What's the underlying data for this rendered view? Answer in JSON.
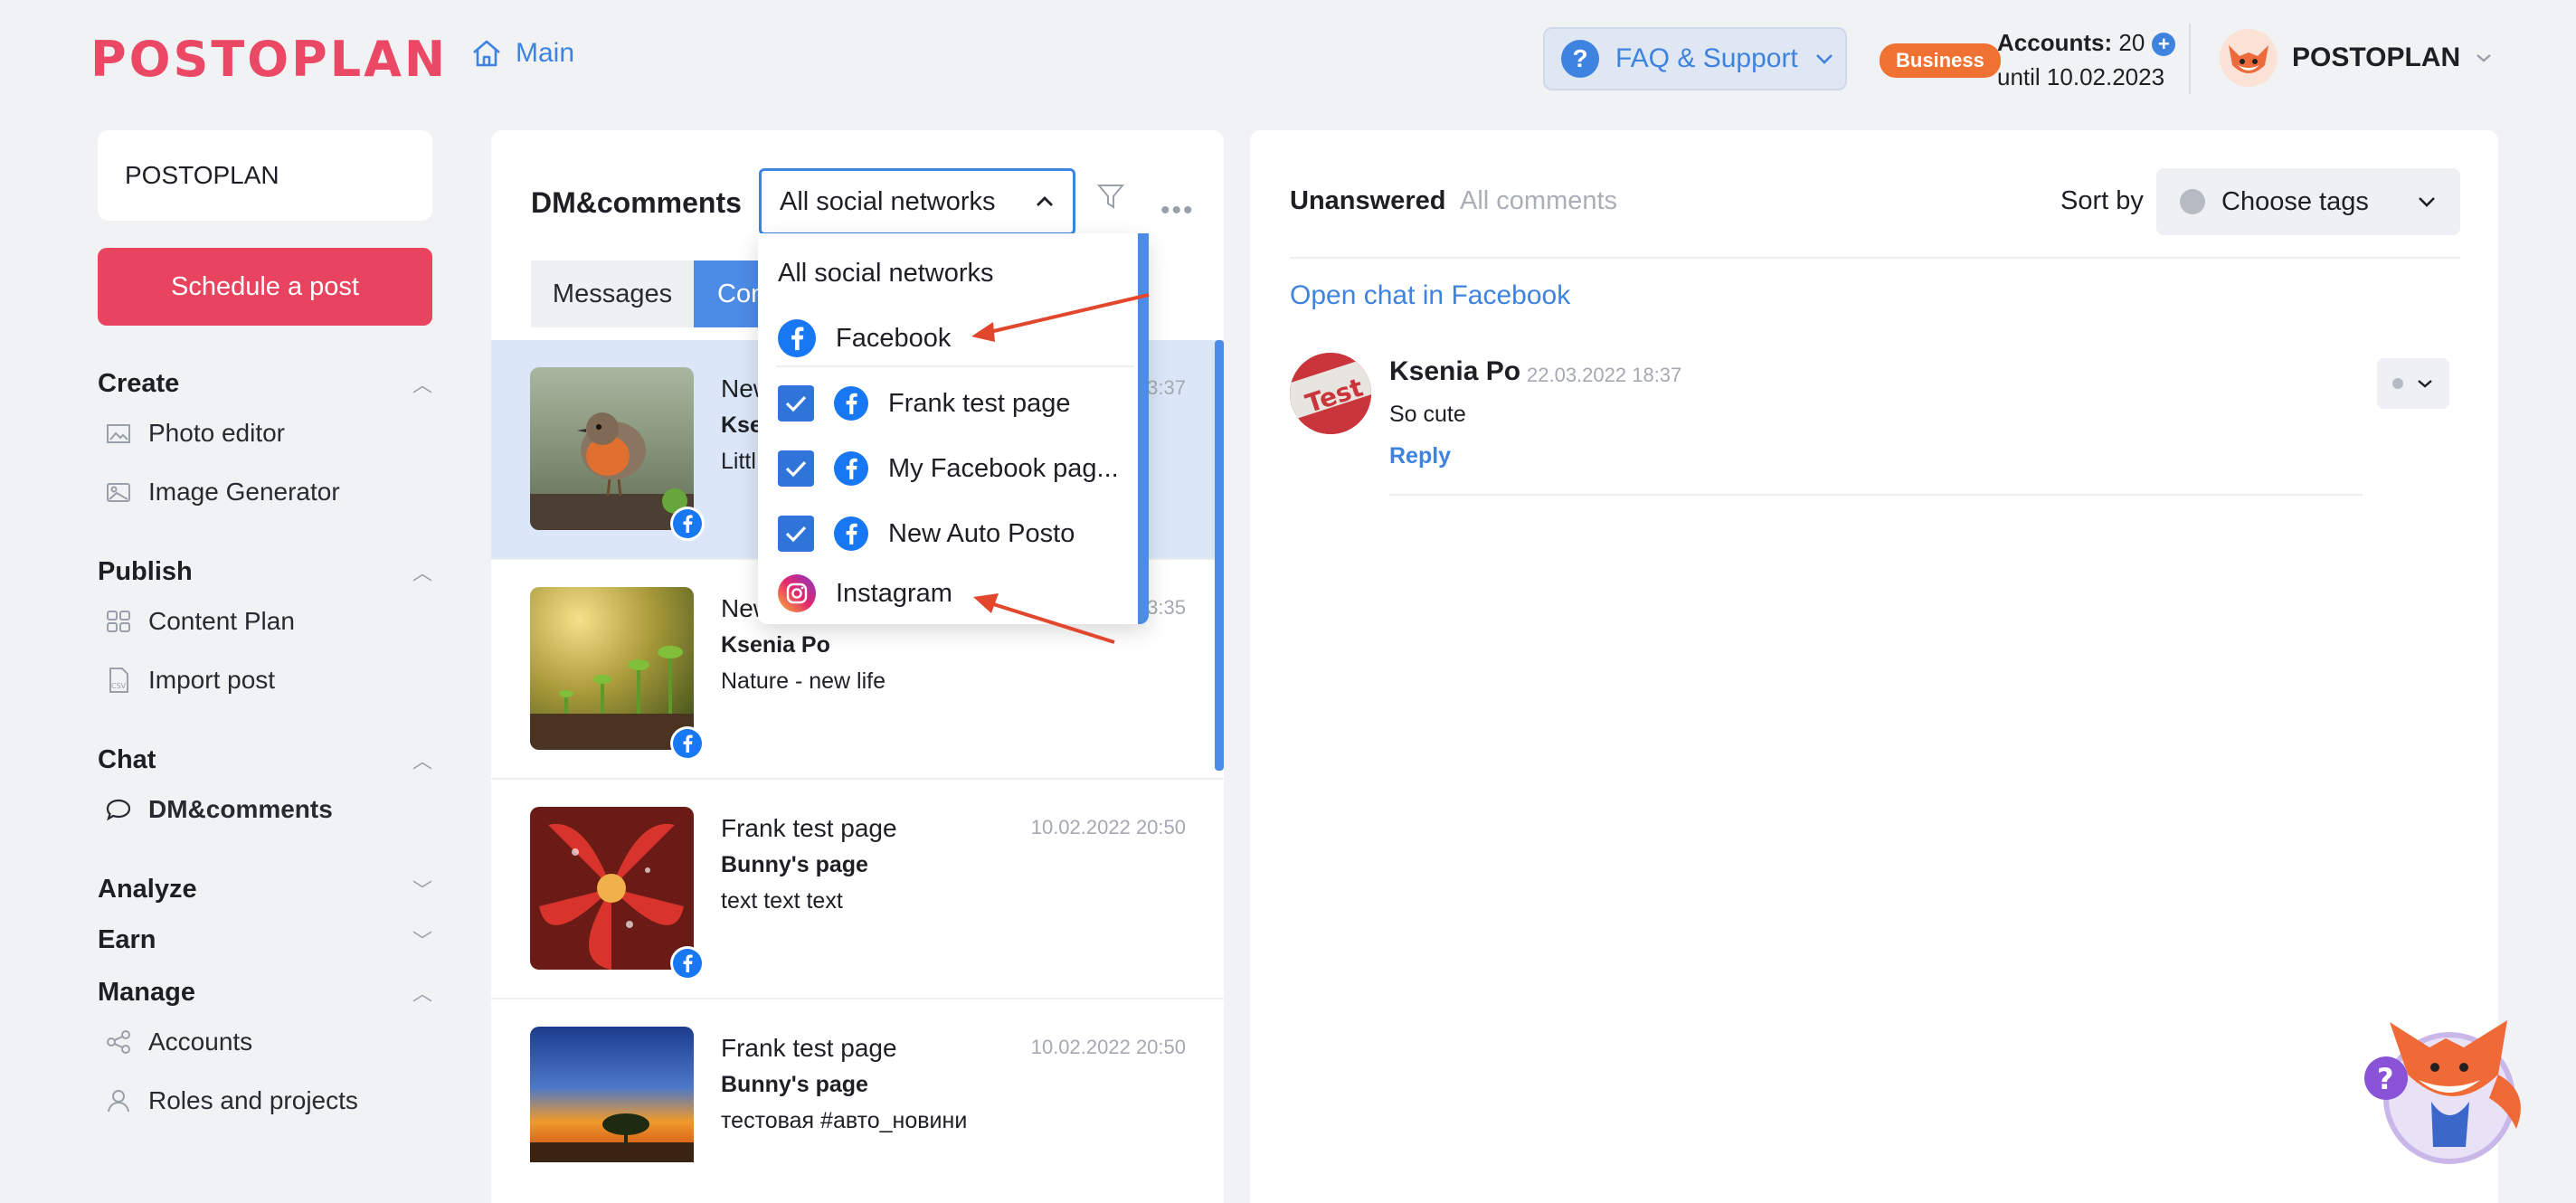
{
  "header": {
    "logo": "POSTOPLAN",
    "home_label": "Main",
    "faq_label": "FAQ & Support",
    "plan_badge": "Business",
    "accounts_label": "Accounts:",
    "accounts_count": "20",
    "until_label": "until 10.02.2023",
    "profile_name": "POSTOPLAN"
  },
  "sidebar": {
    "workspace": "POSTOPLAN",
    "schedule_button": "Schedule a post",
    "sections": {
      "create": "Create",
      "publish": "Publish",
      "chat": "Chat",
      "analyze": "Analyze",
      "earn": "Earn",
      "manage": "Manage"
    },
    "items": {
      "photo_editor": "Photo editor",
      "image_generator": "Image Generator",
      "content_plan": "Content Plan",
      "import_post": "Import post",
      "dm_comments": "DM&comments",
      "accounts": "Accounts",
      "roles_projects": "Roles and projects"
    }
  },
  "center": {
    "title": "DM&comments",
    "network_select": "All social networks",
    "tabs": [
      "Messages",
      "Con"
    ],
    "items": [
      {
        "name": "New",
        "sub": "Kse",
        "text": "Littl",
        "date": "3:37"
      },
      {
        "name": "New",
        "sub": "Ksenia Po",
        "text": "Nature - new life",
        "date": "3:35"
      },
      {
        "name": "Frank test page",
        "sub": "Bunny's page",
        "text": "text text text",
        "date": "10.02.2022 20:50"
      },
      {
        "name": "Frank test page",
        "sub": "Bunny's page",
        "text": "тестовая #авто_новини",
        "date": "10.02.2022 20:50"
      }
    ]
  },
  "dropdown": {
    "all": "All social networks",
    "facebook": "Facebook",
    "pages": [
      "Frank test page",
      "My Facebook pag...",
      "New Auto Posto"
    ],
    "instagram": "Instagram"
  },
  "right": {
    "tab_unanswered": "Unanswered",
    "tab_all": "All comments",
    "sort_by": "Sort by",
    "choose_tags": "Choose tags",
    "open_chat": "Open chat in Facebook",
    "comment": {
      "author": "Ksenia Po",
      "date": "22.03.2022 18:37",
      "text": "So cute",
      "reply": "Reply",
      "avatar_text": "Test"
    }
  },
  "colors": {
    "accent": "#3e83e0",
    "brand": "#ea4864",
    "badge": "#ef7232",
    "arrow": "#e2462c"
  }
}
